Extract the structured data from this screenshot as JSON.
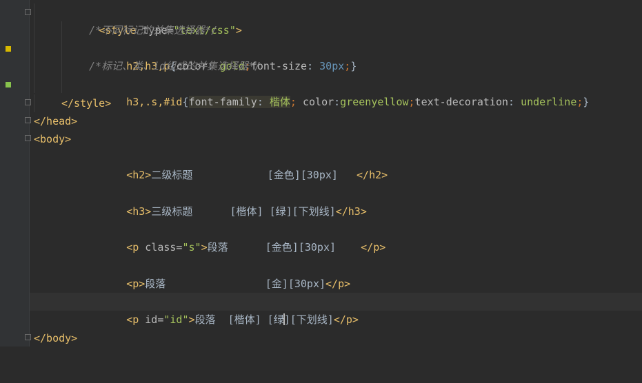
{
  "editor": {
    "lines": [
      {
        "t1": "<style",
        "t2": " type=",
        "t3": "\"text/css\"",
        "t4": ">"
      },
      {
        "c": "/*不同标记的并集选择器*/"
      },
      {
        "s1": "h2,h3,p",
        "s2": "{",
        "p1": "color",
        "s3": ": ",
        "v1": "gold",
        "s4": ";",
        "p2": "font-size",
        "s5": ": ",
        "n1": "30px",
        "s6": ";",
        "s7": "}"
      },
      {
        "c": "/*标记、类、id组成的并集选择器*/"
      },
      {
        "s1": "h3,.s,#id",
        "s2": "{",
        "p1": "font-family",
        "s3": ": ",
        "v1": "楷体",
        "s4": ";",
        "p2": " color",
        "s5": ":",
        "v2": "greenyellow",
        "s6": ";",
        "p3": "text-decoration",
        "s7": ": ",
        "v3": "underline",
        "s8": ";",
        "s9": "}"
      },
      {
        "t1": "</style>"
      },
      {
        "t1": "</head>"
      },
      {
        "t1": "<body>"
      },
      {
        "t1": "<h2>",
        "x": "二级标题            [金色][30px]   ",
        "t2": "</h2>"
      },
      {
        "t1": "<h3>",
        "x": "三级标题      [楷体] [绿][下划线]",
        "t2": "</h3>"
      },
      {
        "t1": "<p",
        "a1": " class=",
        "st": "\"s\"",
        "t2": ">",
        "x": "段落      [金色][30px]    ",
        "t3": "</p>"
      },
      {
        "t1": "<p>",
        "x": "段落                [金][30px]",
        "t2": "</p>"
      },
      {
        "t1": "<p",
        "a1": " id=",
        "st": "\"id\"",
        "t2": ">",
        "x1": "段落  [楷体] [绿",
        "x2": "][下划线]",
        "t3": "</p>"
      },
      {
        "t1": "</body>"
      }
    ]
  },
  "colors": {
    "background": "#2b2b2b",
    "gutter": "#313335",
    "tag": "#e8bf6a",
    "string": "#a5c25c",
    "comment": "#808080",
    "number": "#6897bb"
  }
}
